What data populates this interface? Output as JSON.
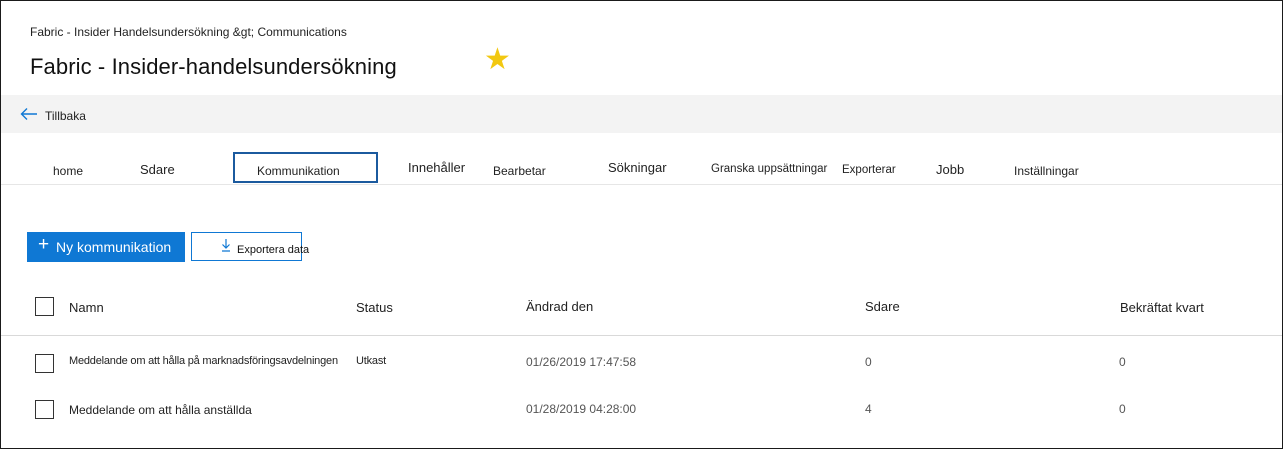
{
  "header": {
    "breadcrumb": "Fabric - Insider Handelsundersökning &gt; Communications",
    "title": "Fabric - Insider-handelsundersökning",
    "favorite_icon": "star-icon",
    "favorite_color": "#f2c811"
  },
  "nav": {
    "back_label": "Tillbaka",
    "back_icon": "arrow-left-icon"
  },
  "tabs": [
    {
      "label": "home"
    },
    {
      "label": "Sdare"
    },
    {
      "label": "Kommunikation",
      "selected": true
    },
    {
      "label": "Innehåller"
    },
    {
      "label": "Bearbetar"
    },
    {
      "label": "Sökningar"
    },
    {
      "label": "Granska uppsättningar"
    },
    {
      "label": "Exporterar"
    },
    {
      "label": "Jobb"
    },
    {
      "label": "Inställningar"
    }
  ],
  "toolbar": {
    "new_label": "Ny kommunikation",
    "new_icon": "plus-icon",
    "export_label": "Exportera data",
    "export_icon": "download-icon",
    "accent_color": "#0f78d4"
  },
  "table": {
    "columns": [
      "Namn",
      "Status",
      "Ändrad den",
      "Sdare",
      "Bekräftat kvart"
    ],
    "rows": [
      {
        "name": "Meddelande om att hålla på marknadsföringsavdelningen",
        "status": "Utkast",
        "modified": "01/26/2019 17:47:58",
        "sdare": "0",
        "confirmed": "0"
      },
      {
        "name": "Meddelande om att hålla anställda",
        "status": "",
        "modified": "01/28/2019 04:28:00",
        "sdare": "4",
        "confirmed": "0"
      }
    ]
  }
}
